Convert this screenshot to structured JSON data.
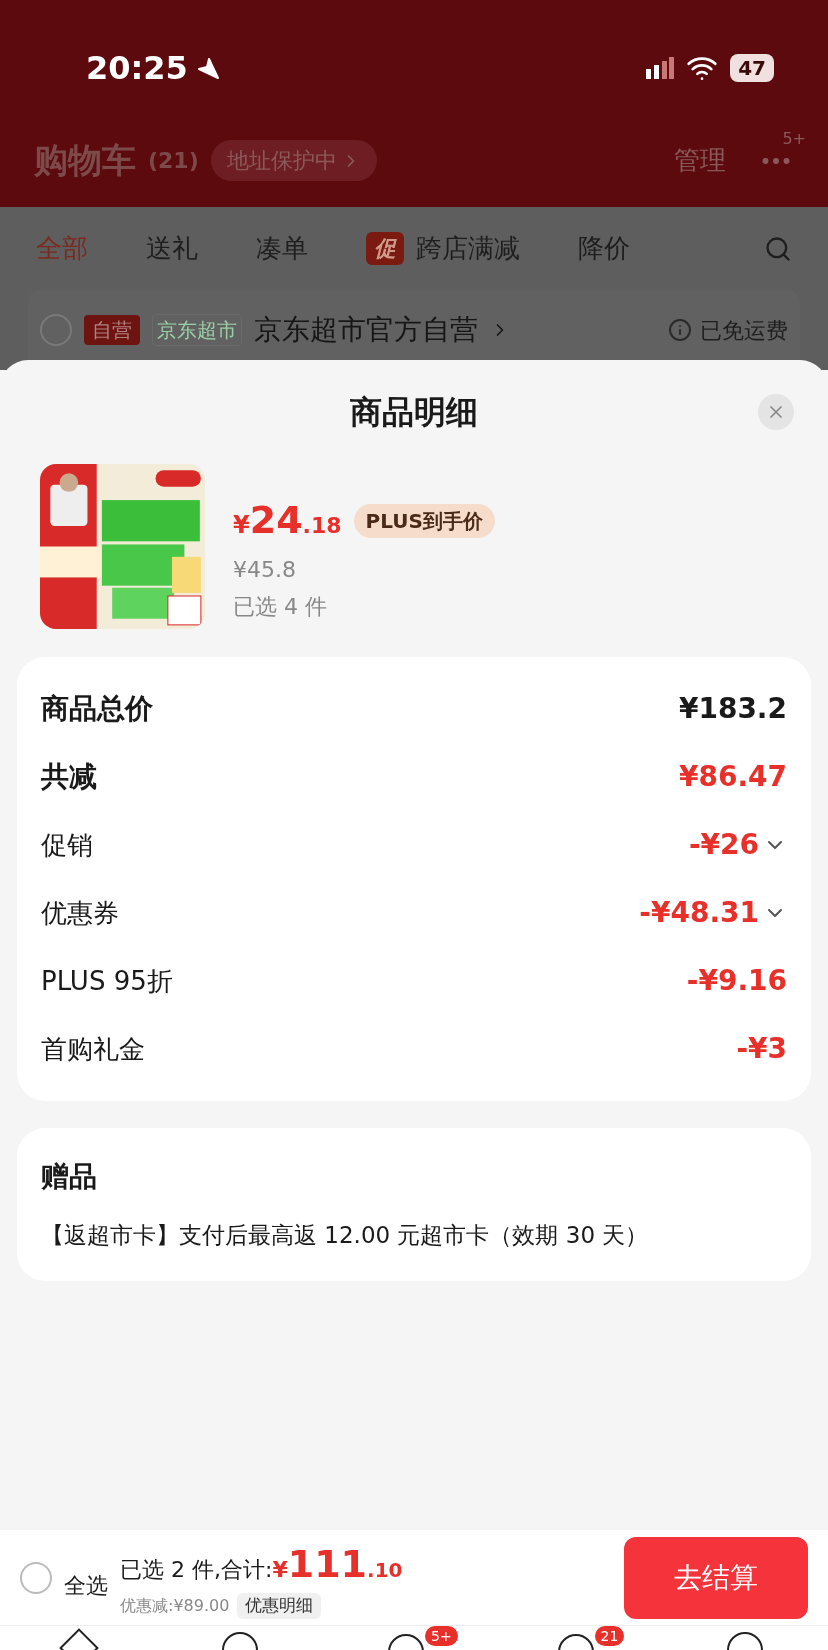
{
  "status_bar": {
    "time": "20:25",
    "battery": "47"
  },
  "header": {
    "title": "购物车",
    "count": "(21)",
    "address_chip": "地址保护中",
    "manage": "管理",
    "more_badge": "5+"
  },
  "filter_tabs": [
    {
      "label": "全部",
      "selected": true
    },
    {
      "label": "送礼",
      "selected": false
    },
    {
      "label": "凑单",
      "selected": false
    },
    {
      "label": "跨店满减",
      "selected": false,
      "promo_tag": "促"
    },
    {
      "label": "降价",
      "selected": false
    }
  ],
  "store": {
    "tags": [
      {
        "label": "自营",
        "kind": "solid"
      },
      {
        "label": "京东超市",
        "kind": "outline"
      }
    ],
    "name": "京东超市官方自营",
    "shipping": "已免运费",
    "checked": false
  },
  "sheet": {
    "title": "商品明细",
    "product": {
      "kind": "picture",
      "price_symbol": "¥",
      "price_int": "24",
      "price_dec": ".18",
      "price_badge": "PLUS到手价",
      "original_price": "¥45.8",
      "selected_count": "已选 4 件"
    },
    "summary": [
      {
        "label": "商品总价",
        "value": "¥183.2",
        "kind": "total",
        "expandable": false
      },
      {
        "label": "共减",
        "value": "¥86.47",
        "kind": "discount_total",
        "expandable": false
      },
      {
        "label": "促销",
        "value": "-¥26",
        "kind": "discount",
        "expandable": true
      },
      {
        "label": "优惠券",
        "value": "-¥48.31",
        "kind": "discount",
        "expandable": true
      },
      {
        "label": "PLUS 95折",
        "value": "-¥9.16",
        "kind": "discount",
        "expandable": false
      },
      {
        "label": "首购礼金",
        "value": "-¥3",
        "kind": "discount",
        "expandable": false
      }
    ],
    "gifts": {
      "title": "赠品",
      "text": "【返超市卡】支付后最高返 12.00 元超市卡（效期 30 天）"
    }
  },
  "checkout_bar": {
    "select_all": "全选",
    "select_all_checked": false,
    "selected_text": "已选 2 件,合计:",
    "total_symbol": "¥",
    "total_int": "111",
    "total_dec": ".10",
    "discount_text": "优惠减:¥89.00",
    "detail_button": "优惠明细",
    "checkout_button": "去结算"
  },
  "tab_bar_badges": [
    {
      "badge": "5+"
    },
    {
      "badge": "21"
    }
  ]
}
